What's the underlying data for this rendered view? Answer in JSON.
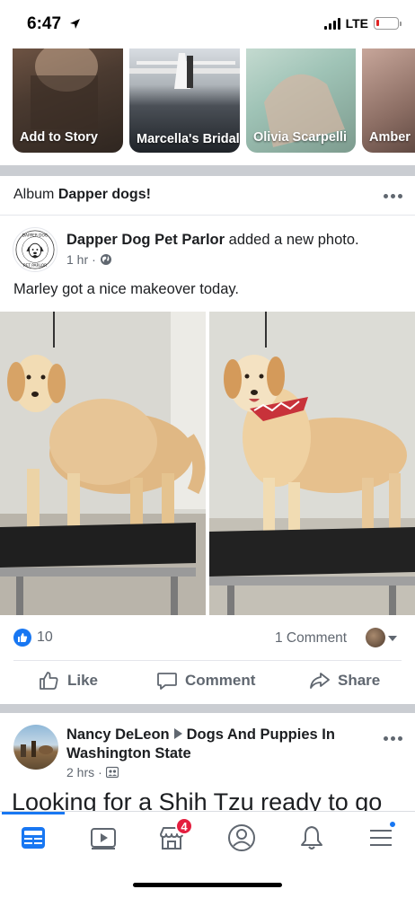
{
  "status_bar": {
    "time": "6:47",
    "network": "LTE",
    "battery_level": 0.12,
    "battery_color": "#e02424"
  },
  "stories": [
    {
      "label": "Add to Story"
    },
    {
      "label": "Marcella's Bridal"
    },
    {
      "label": "Olivia Scarpelli"
    },
    {
      "label": "Amber"
    }
  ],
  "album": {
    "prefix": "Album",
    "name": "Dapper dogs!"
  },
  "post": {
    "author": "Dapper Dog Pet Parlor",
    "action": "added a new photo.",
    "time": "1 hr",
    "text": "Marley got a nice makeover today.",
    "avatar_logo_text": "DAPPER DOG PET PARLOR",
    "like_count": "10",
    "comment_count": "1 Comment",
    "actions": {
      "like": "Like",
      "comment": "Comment",
      "share": "Share"
    }
  },
  "next_post": {
    "author": "Nancy DeLeon",
    "group": "Dogs And Puppies In Washington State",
    "time": "2 hrs",
    "text": "Looking for a Shih Tzu ready to go"
  },
  "tab_bar": {
    "tabs": [
      {
        "name": "news-feed",
        "icon": "news-feed-icon"
      },
      {
        "name": "watch",
        "icon": "video-icon"
      },
      {
        "name": "marketplace",
        "icon": "marketplace-icon",
        "badge": "4"
      },
      {
        "name": "profile",
        "icon": "profile-icon"
      },
      {
        "name": "notifications",
        "icon": "bell-icon"
      },
      {
        "name": "menu",
        "icon": "menu-icon"
      }
    ],
    "active": "news-feed",
    "accent": "#1877f2"
  },
  "colors": {
    "accent": "#1877f2",
    "badge": "#e41e3f",
    "text_secondary": "#606770"
  }
}
